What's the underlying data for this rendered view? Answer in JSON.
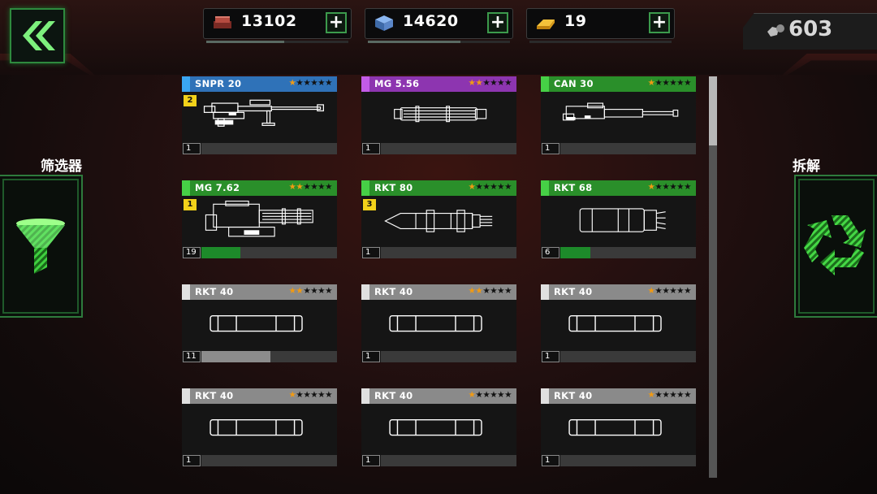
{
  "resources": [
    {
      "name": "armor-plates",
      "icon": "armor-plate-icon",
      "value": "13102",
      "fill": 0.55,
      "color": "#a8453b"
    },
    {
      "name": "parts-crates",
      "icon": "crate-icon",
      "value": "14620",
      "fill": 0.65,
      "color": "#4a7ac9"
    },
    {
      "name": "gold-bars",
      "icon": "gold-bar-icon",
      "value": "19",
      "fill": 0.0,
      "color": "#e8a61b"
    }
  ],
  "plus_label": "+",
  "components_count": "603",
  "filter": {
    "label": "筛选器",
    "icon": "funnel-icon"
  },
  "disassemble": {
    "label": "拆解",
    "icon": "recycle-icon"
  },
  "colors": {
    "sniper": "#2b8fd8",
    "mg556": "#a13fc9",
    "uncommon": "#2fa32f",
    "common": "#9a9a9a",
    "star_on": "#f09a14",
    "progress_green": "#1d8a2a",
    "progress_gray": "#8c8c8c"
  },
  "cards": [
    {
      "name": "SNPR 20",
      "stripe": "#3aa6f2",
      "header": "#2f72b8",
      "stars": 1,
      "tier": "2",
      "count": "1",
      "progress": 0,
      "art": "sniper"
    },
    {
      "name": "MG 5.56",
      "stripe": "#c35be8",
      "header": "#8d35b0",
      "stars": 2,
      "tier": "",
      "count": "1",
      "progress": 0,
      "art": "minigun"
    },
    {
      "name": "CAN 30",
      "stripe": "#46d046",
      "header": "#2a8f2a",
      "stars": 1,
      "tier": "",
      "count": "1",
      "progress": 0,
      "art": "cannon"
    },
    {
      "name": "MG 7.62",
      "stripe": "#46d046",
      "header": "#2a8f2a",
      "stars": 2,
      "tier": "1",
      "count": "19",
      "progress": 0.29,
      "progress_color": "#1d8a2a",
      "art": "heavy-mg"
    },
    {
      "name": "RKT 80",
      "stripe": "#46d046",
      "header": "#2a8f2a",
      "stars": 1,
      "tier": "3",
      "count": "1",
      "progress": 0,
      "art": "rocket-pod"
    },
    {
      "name": "RKT 68",
      "stripe": "#46d046",
      "header": "#2a8f2a",
      "stars": 1,
      "tier": "",
      "count": "6",
      "progress": 0.22,
      "progress_color": "#1d8a2a",
      "art": "rocket-launcher"
    },
    {
      "name": "RKT 40",
      "stripe": "#e0e0e0",
      "header": "#8a8a8a",
      "stars": 2,
      "tier": "",
      "count": "11",
      "progress": 0.51,
      "progress_color": "#8c8c8c",
      "art": "tube"
    },
    {
      "name": "RKT 40",
      "stripe": "#e0e0e0",
      "header": "#8a8a8a",
      "stars": 2,
      "tier": "",
      "count": "1",
      "progress": 0,
      "art": "tube"
    },
    {
      "name": "RKT 40",
      "stripe": "#e0e0e0",
      "header": "#8a8a8a",
      "stars": 1,
      "tier": "",
      "count": "1",
      "progress": 0,
      "art": "tube"
    },
    {
      "name": "RKT 40",
      "stripe": "#e0e0e0",
      "header": "#8a8a8a",
      "stars": 1,
      "tier": "",
      "count": "1",
      "progress": 0,
      "art": "tube"
    },
    {
      "name": "RKT 40",
      "stripe": "#e0e0e0",
      "header": "#8a8a8a",
      "stars": 1,
      "tier": "",
      "count": "1",
      "progress": 0,
      "art": "tube"
    },
    {
      "name": "RKT 40",
      "stripe": "#e0e0e0",
      "header": "#8a8a8a",
      "stars": 1,
      "tier": "",
      "count": "1",
      "progress": 0,
      "art": "tube"
    }
  ]
}
